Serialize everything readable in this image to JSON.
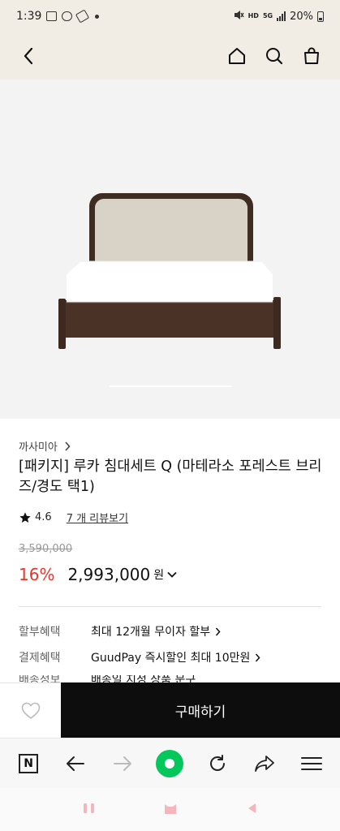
{
  "status_bar": {
    "time": "1:39",
    "network": "HD",
    "signal": "5G",
    "battery": "20%"
  },
  "header": {
    "back_icon": "chevron-left-icon",
    "home_icon": "home-icon",
    "search_icon": "search-icon",
    "cart_icon": "shopping-bag-icon"
  },
  "hero": {
    "image_alt": "bed-product-image"
  },
  "product": {
    "brand": "까사미아",
    "title": "[패키지] 루카 침대세트 Q (마테라소 포레스트 브리즈/경도 택1)",
    "rating": "4.6",
    "review_link": "7 개 리뷰보기",
    "original_price": "3,590,000",
    "discount": "16%",
    "price": "2,993,000",
    "currency": "원"
  },
  "benefits": [
    {
      "label": "할부혜택",
      "value": "최대 12개월 무이자 할부"
    },
    {
      "label": "결제혜택",
      "value": "GuudPay 즉시할인 최대 10만원"
    },
    {
      "label": "배송정보",
      "value": "배송일 지정 상품 문구"
    }
  ],
  "actions": {
    "buy_label": "구매하기"
  },
  "browser": {
    "n_label": "N"
  },
  "colors": {
    "header_bg": "#f1ede4",
    "discount": "#e8332b",
    "buy_bg": "#0d0d0d",
    "naver_green": "#03c75a"
  }
}
